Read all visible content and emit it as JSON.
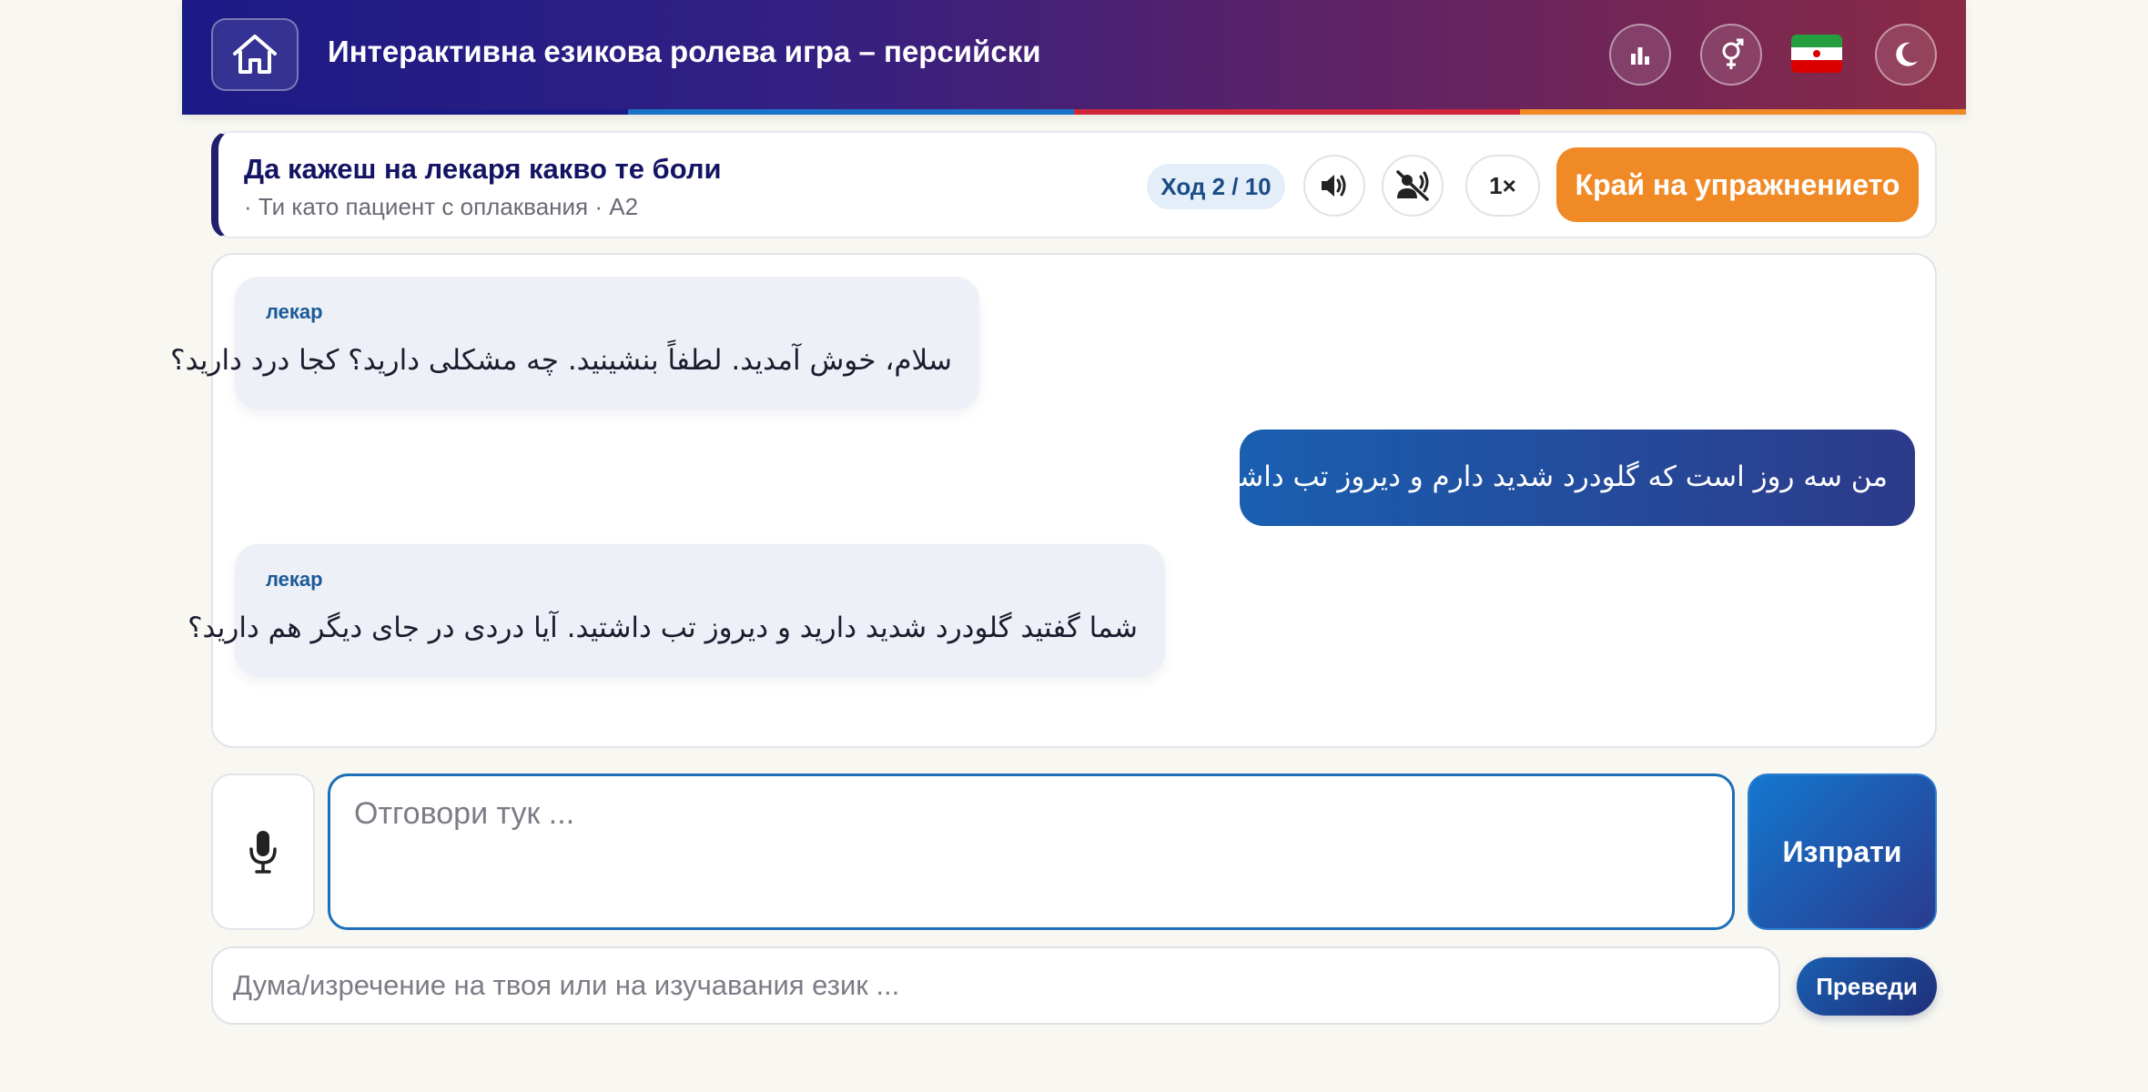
{
  "header": {
    "title": "Интерактивна езикова ролева игра – персийски",
    "stripe_colors": [
      "#1b1a86",
      "#1a73c9",
      "#d0263a",
      "#f08a26"
    ],
    "icons": {
      "home": "home-icon",
      "stats": "bar-chart-icon",
      "gender": "gender-icon",
      "flag": "iran-flag-icon",
      "theme": "moon-icon"
    }
  },
  "scenario": {
    "title": "Да кажеш на лекаря какво те боли",
    "subtitle": "· Ти като пациент с оплаквания · A2",
    "turn_label": "Ход 2 / 10",
    "speed_label": "1×",
    "end_button": "Край на упражнението",
    "accent_color": "#f08a26"
  },
  "chat": {
    "messages": [
      {
        "role": "bot",
        "speaker": "лекар",
        "text": "سلام، خوش آمدید. لطفاً بنشینید. چه مشکلی دارید؟ کجا درد دارید؟"
      },
      {
        "role": "user",
        "text": "من سه روز است که گلودرد شدید دارم و دیروز تب داشتم."
      },
      {
        "role": "bot",
        "speaker": "лекар",
        "text": "شما گفتید گلودرد شدید دارید و دیروز تب داشتید. آیا دردی در جای دیگر هم دارید؟"
      }
    ]
  },
  "input": {
    "answer_placeholder": "Отговори тук ...",
    "send_label": "Изпрати",
    "translate_placeholder": "Дума/изречение на твоя или на изучавания език ...",
    "translate_label": "Преведи"
  }
}
